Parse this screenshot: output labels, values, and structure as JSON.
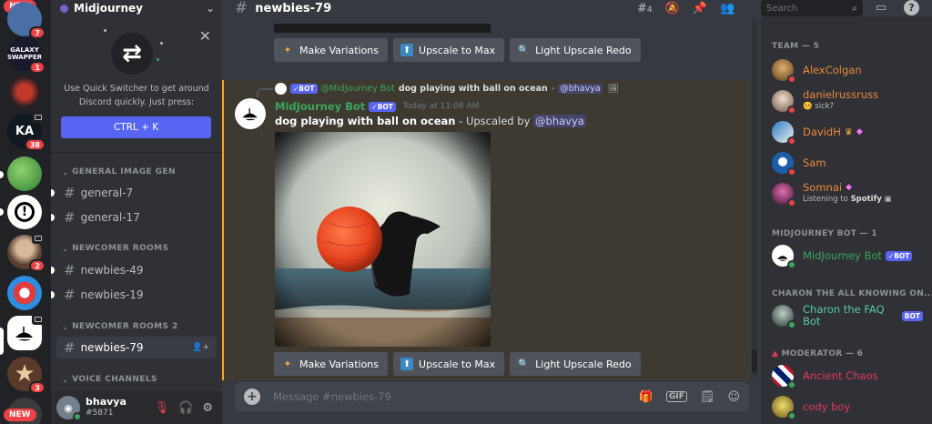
{
  "colors": {
    "accent": "#5865f2",
    "online": "#3ba55d",
    "dnd": "#ed4245",
    "team": "#e8893a",
    "moderator": "#e0385f",
    "charon": "#56c9a5"
  },
  "rail": {
    "new_top": "NEW",
    "new_bottom": "NEW",
    "badges": [
      "7",
      "1",
      "38",
      "2",
      "3"
    ],
    "galaxy_label": "GALAXY SWAPPER",
    "ka_label": "KA"
  },
  "guild": {
    "name": "Midjourney"
  },
  "quick_switcher": {
    "text": "Use Quick Switcher to get around Discord quickly. Just press:",
    "button": "CTRL + K"
  },
  "categories": {
    "general": "GENERAL IMAGE GEN",
    "newcomer": "NEWCOMER ROOMS",
    "newcomer2": "NEWCOMER ROOMS 2",
    "voice": "VOICE CHANNELS"
  },
  "channels_list": {
    "general7": "general-7",
    "general17": "general-17",
    "newbies49": "newbies-49",
    "newbies19": "newbies-19",
    "newbies79": "newbies-79"
  },
  "user": {
    "name": "bhavya",
    "tag": "#5871"
  },
  "topbar": {
    "channel": "newbies-79",
    "threads": "4",
    "search_placeholder": "Search"
  },
  "buttons": {
    "variations": "Make Variations",
    "upscale_max": "Upscale to Max",
    "light_redo": "Light Upscale Redo"
  },
  "message": {
    "reply_bot_label": "BOT",
    "reply_author": "@MidJourney Bot",
    "reply_text": "dog playing with ball on ocean",
    "reply_sep": "-",
    "reply_mention": "@bhavya",
    "author": "MidJourney Bot",
    "bot_label": "BOT",
    "timestamp": "Today at 11:08 AM",
    "prompt": "dog playing with ball on ocean",
    "suffix": " - Upscaled by ",
    "mention": "@bhavya"
  },
  "composer": {
    "placeholder": "Message #newbies-79",
    "gif": "GIF"
  },
  "members": {
    "team_header": "TEAM — 5",
    "mj_header": "MIDJOURNEY BOT — 1",
    "charon_header": "CHARON THE ALL KNOWING ON...",
    "mod_header": "MODERATOR — 6",
    "alex": "AlexColgan",
    "daniel": "danielrussruss",
    "daniel_status": "sick?",
    "david": "DavidH",
    "sam": "Sam",
    "somnai": "Somnai",
    "somnai_status_pre": "Listening to ",
    "somnai_status_app": "Spotify",
    "mjbot": "MidJourney Bot",
    "mjbot_tag": "BOT",
    "charon": "Charon the FAQ Bot",
    "charon_tag": "BOT",
    "ancient": "Ancient Chaos",
    "cody": "cody boy"
  }
}
